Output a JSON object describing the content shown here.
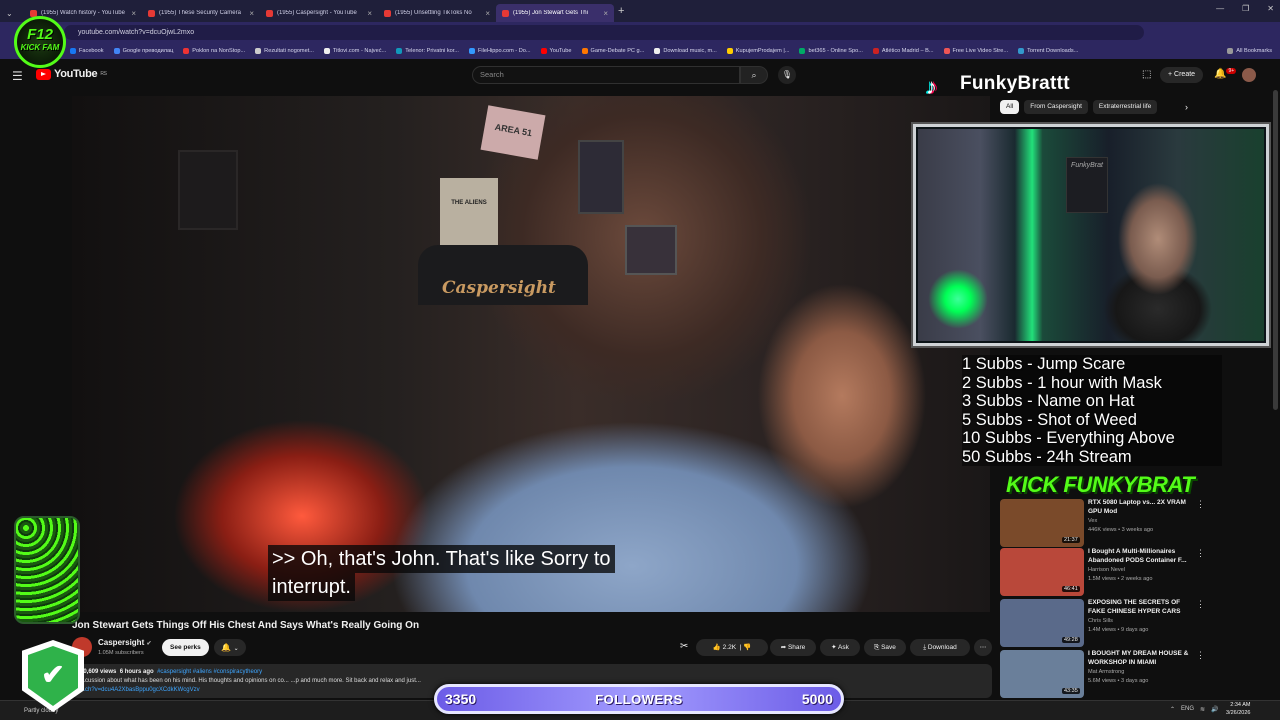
{
  "browser": {
    "tabs": [
      {
        "label": "(1955) Watch history - YouTube",
        "active": false
      },
      {
        "label": "(1955) These Security Camera",
        "active": false
      },
      {
        "label": "(1955) Caspersight - YouTube",
        "active": false
      },
      {
        "label": "(1955) Unsettling TikToks No",
        "active": false
      },
      {
        "label": "(1955) Jon Stewart Gets Thi",
        "active": true
      }
    ],
    "url": "youtube.com/watch?v=dcuOjwL2mxo",
    "bookmarks": [
      "Facebook",
      "Google преводилац",
      "Poklon na NonStop...",
      "Rezultati nogomet...",
      "Titlovi.com - Najveć...",
      "Telenor: Privatni kor...",
      "FileHippo.com - Do...",
      "YouTube",
      "Game-Debate PC g...",
      "Download music, m...",
      "KupujemProdajem |...",
      "bet365 - Online Spo...",
      "Atlético Madrid – B...",
      "Free Live Video Stre...",
      "Torrent Downloads..."
    ],
    "all_bookmarks": "All Bookmarks"
  },
  "yt": {
    "logo": "YouTube",
    "logo_sup": "RS",
    "search_placeholder": "Search",
    "create": "Create",
    "notif_count": "9+"
  },
  "video": {
    "chair_brand": "Caspersight",
    "sign": "AREA 51",
    "poster": "THE ALIENS",
    "captions": [
      ">> Oh, that's John. That's like Sorry to",
      "interrupt."
    ],
    "title": "Jon Stewart Gets Things Off His Chest And Says What's Really Going On",
    "channel": "Caspersight",
    "subscribers": "1.05M subscribers",
    "perks": "See perks",
    "likes": "2.2K",
    "share": "Share",
    "ask": "Ask",
    "save": "Save",
    "download": "Download",
    "views": "30,609 views",
    "age": "6 hours ago",
    "tags": "#caspersight #aliens #conspiracytheory",
    "desc_line": "...cussion about what  has been on his mind. His thoughts and opinions on co...                                                     ...p and much more. Sit back and relax and just...",
    "desc_link": "...ch?v=dcu4A2XbasBppu0gcXCdkKWcgVzv"
  },
  "stream": {
    "tiktok_name": "FunkyBrattt",
    "chips": [
      {
        "label": "All",
        "active": true
      },
      {
        "label": "From Caspersight",
        "active": false
      },
      {
        "label": "Extraterrestrial life",
        "active": false
      }
    ],
    "subs": [
      "1 Subbs - Jump Scare",
      "2 Subbs - 1 hour with Mask",
      "3 Subbs - Name on Hat",
      "5 Subbs - Shot of Weed",
      "10 Subbs - Everything Above",
      "50 Subbs - 24h Stream"
    ],
    "kick_banner": "KICK FUNKYBRAT",
    "f12_top": "F12",
    "f12_bottom": "KICK FAM",
    "followers_current": "3350",
    "followers_label": "FOLLOWERS",
    "followers_goal": "5000"
  },
  "recs": [
    {
      "title": "RTX 5080 Laptop vs... 2X VRAM GPU Mod",
      "channel": "Vex",
      "meta": "446K views • 3 weeks ago",
      "duration": "21:37",
      "color": "#7a4a2a"
    },
    {
      "title": "I Bought A Multi-Millionaires Abandoned PODS Container F...",
      "channel": "Harrison Nevel",
      "meta": "1.5M views • 2 weeks ago",
      "duration": "46:41",
      "color": "#b9483a"
    },
    {
      "title": "EXPOSING THE SECRETS OF FAKE CHINESE HYPER CARS",
      "channel": "Chris Sills",
      "meta": "1.4M views • 9 days ago",
      "duration": "49:28",
      "color": "#5a6a8a"
    },
    {
      "title": "I BOUGHT MY DREAM HOUSE & WORKSHOP IN MIAMI",
      "channel": "Mat Armstrong",
      "meta": "5.6M views • 3 days ago",
      "duration": "43:35",
      "color": "#6a7f9a"
    }
  ],
  "taskbar": {
    "weather": "Partly cloudy",
    "time": "2:34 AM",
    "date": "3/26/2026",
    "lang": "ENG"
  },
  "colors": {
    "yt_red": "#ff0000",
    "kick_green": "#53fc18",
    "followers_purple": "#6c5ce7"
  }
}
